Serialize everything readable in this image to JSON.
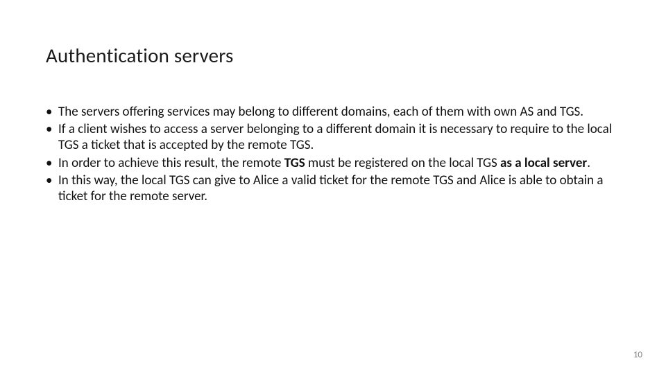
{
  "slide": {
    "title": "Authentication servers",
    "bullets": [
      {
        "plain": "The servers offering services may belong to different domains, each of them with own AS and TGS."
      },
      {
        "plain": "If a client wishes to access a server belonging to a different domain it is necessary to require  to the local TGS a ticket that is accepted by the remote TGS."
      },
      {
        "pre": "In order to achieve this result, the remote ",
        "b1": "TGS",
        "mid": " must be registered on the local TGS ",
        "b2": "as a local server",
        "post": "."
      },
      {
        "plain": "In this way, the local TGS can give to Alice a valid ticket  for the remote TGS and Alice is able to obtain a ticket for the remote server."
      }
    ],
    "page_number": "10"
  }
}
